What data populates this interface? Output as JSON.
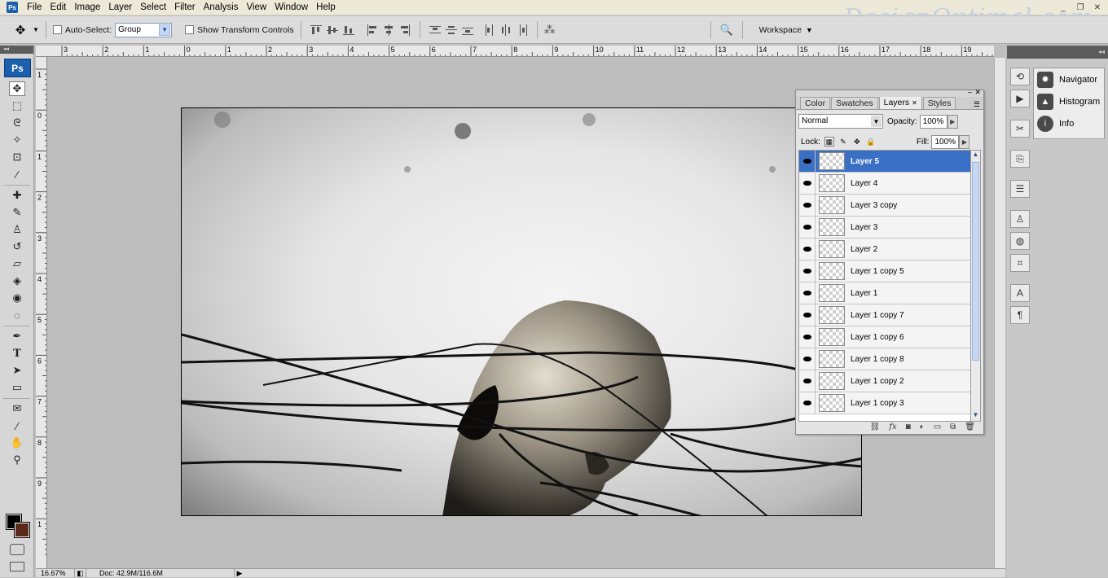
{
  "menubar": {
    "app_icon": "Ps",
    "items": [
      "File",
      "Edit",
      "Image",
      "Layer",
      "Select",
      "Filter",
      "Analysis",
      "View",
      "Window",
      "Help"
    ],
    "watermark": "DesignOptimal.com",
    "window_controls": [
      "_",
      "❐",
      "✕"
    ]
  },
  "options_bar": {
    "auto_select_label": "Auto-Select:",
    "auto_select_value": "Group",
    "show_transform_label": "Show Transform Controls",
    "workspace_label": "Workspace"
  },
  "toolbox": {
    "logo": "Ps",
    "tools": [
      "move-tool",
      "marquee-tool",
      "lasso-tool",
      "magic-wand-tool",
      "crop-tool",
      "eyedropper-tool",
      "healing-brush-tool",
      "brush-tool",
      "clone-stamp-tool",
      "history-brush-tool",
      "eraser-tool",
      "paint-bucket-tool",
      "blur-tool",
      "dodge-tool",
      "pen-tool",
      "type-tool",
      "path-selection-tool",
      "shape-tool",
      "notes-tool",
      "color-sampler-tool",
      "hand-tool",
      "zoom-tool"
    ],
    "foreground_color": "#000000",
    "background_color": "#5a2a18"
  },
  "ruler_top": [
    "3",
    "2",
    "1",
    "0",
    "1",
    "2",
    "3",
    "4",
    "5",
    "6",
    "7",
    "8",
    "9",
    "10",
    "11",
    "12",
    "13",
    "14",
    "15",
    "16",
    "17",
    "18",
    "19"
  ],
  "ruler_left": [
    "1",
    "0",
    "1",
    "2",
    "3",
    "4",
    "5",
    "6",
    "7",
    "8",
    "9",
    "1"
  ],
  "status": {
    "zoom": "16.67%",
    "doc": "Doc: 42.9M/116.6M"
  },
  "right_dock": {
    "panels": [
      "Navigator",
      "Histogram",
      "Info"
    ]
  },
  "layers_panel": {
    "tabs": [
      "Color",
      "Swatches",
      "Layers",
      "Styles"
    ],
    "active_tab": "Layers",
    "blend_mode": "Normal",
    "opacity_label": "Opacity:",
    "opacity_value": "100%",
    "lock_label": "Lock:",
    "fill_label": "Fill:",
    "fill_value": "100%",
    "layers": [
      "Layer 5",
      "Layer 4",
      "Layer 3 copy",
      "Layer 3",
      "Layer 2",
      "Layer 1 copy 5",
      "Layer 1",
      "Layer 1 copy 7",
      "Layer 1 copy 6",
      "Layer 1 copy 8",
      "Layer 1 copy 2",
      "Layer 1 copy 3"
    ],
    "selected_layer": "Layer 5",
    "footer_icons": [
      "link-icon",
      "fx-icon",
      "mask-icon",
      "adjustment-icon",
      "group-icon",
      "new-layer-icon",
      "trash-icon"
    ]
  }
}
